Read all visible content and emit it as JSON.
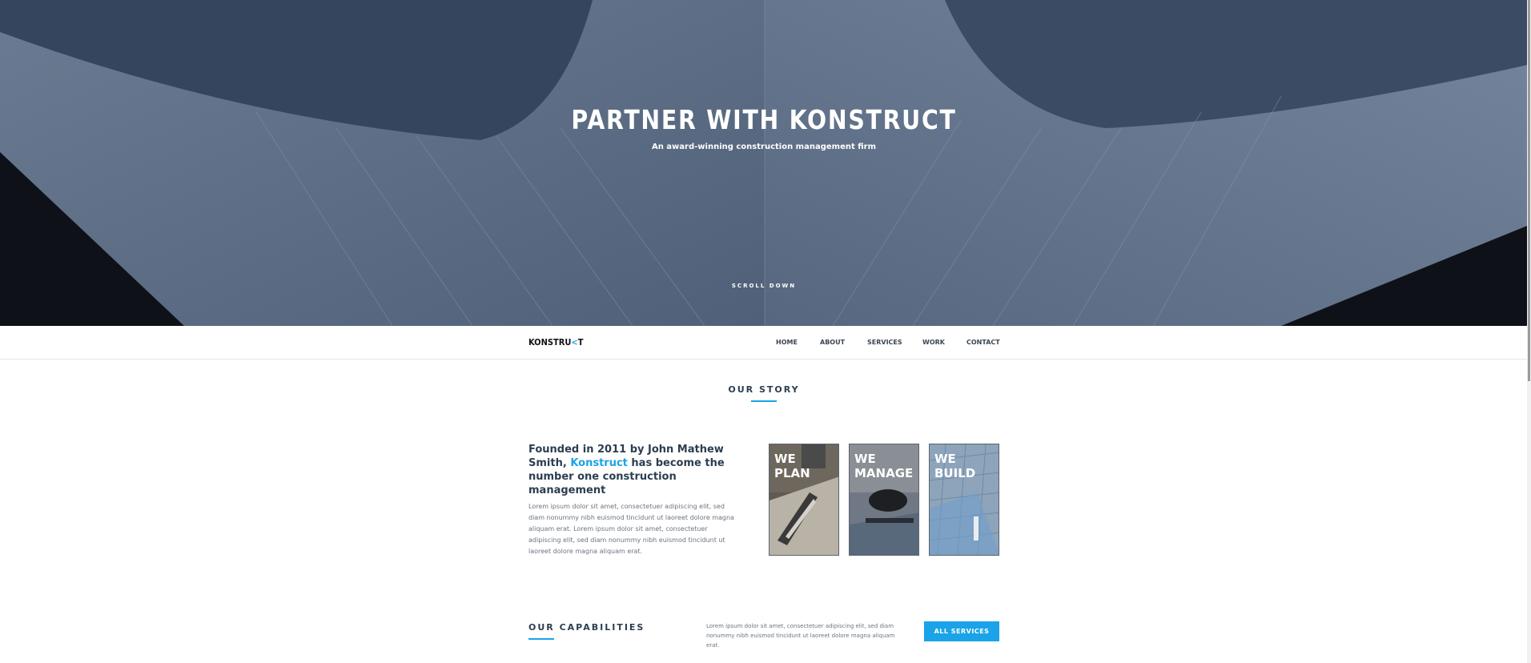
{
  "hero": {
    "title": "PARTNER WITH KONSTRUCT",
    "subtitle": "An award-winning construction management firm",
    "scroll_label": "SCROLL DOWN"
  },
  "nav": {
    "logo_main": "KONSTRU",
    "logo_accent": "<",
    "logo_end": "T",
    "links": [
      "HOME",
      "ABOUT",
      "SERVICES",
      "WORK",
      "CONTACT"
    ]
  },
  "story": {
    "section_title": "OUR STORY",
    "heading_pre": "Founded in 2011 by John Mathew Smith, ",
    "heading_brand": "Konstruct",
    "heading_post": " has become the number one construction management",
    "body": "Lorem ipsum dolor sit amet, consectetuer adipiscing elit, sed diam nonummy nibh euismod tincidunt ut laoreet dolore magna aliquam erat. Lorem ipsum dolor sit amet, consectetuer adipiscing elit, sed diam nonummy nibh euismod tincidunt ut laoreet dolore magna aliquam erat.",
    "cards": [
      {
        "line1": "WE",
        "line2": "PLAN"
      },
      {
        "line1": "WE",
        "line2": "MANAGE"
      },
      {
        "line1": "WE",
        "line2": "BUILD"
      }
    ]
  },
  "capabilities": {
    "title": "OUR CAPABILITIES",
    "text": "Lorem ipsum dolor sit amet, consectetuer adipiscing elit, sed diam nonummy nibh euismod tincidunt ut laoreet dolore magna aliquam erat.",
    "button": "ALL SERVICES"
  },
  "colors": {
    "accent": "#1aa3e8",
    "heading": "#2c3e50",
    "body_text": "#6b7580"
  }
}
